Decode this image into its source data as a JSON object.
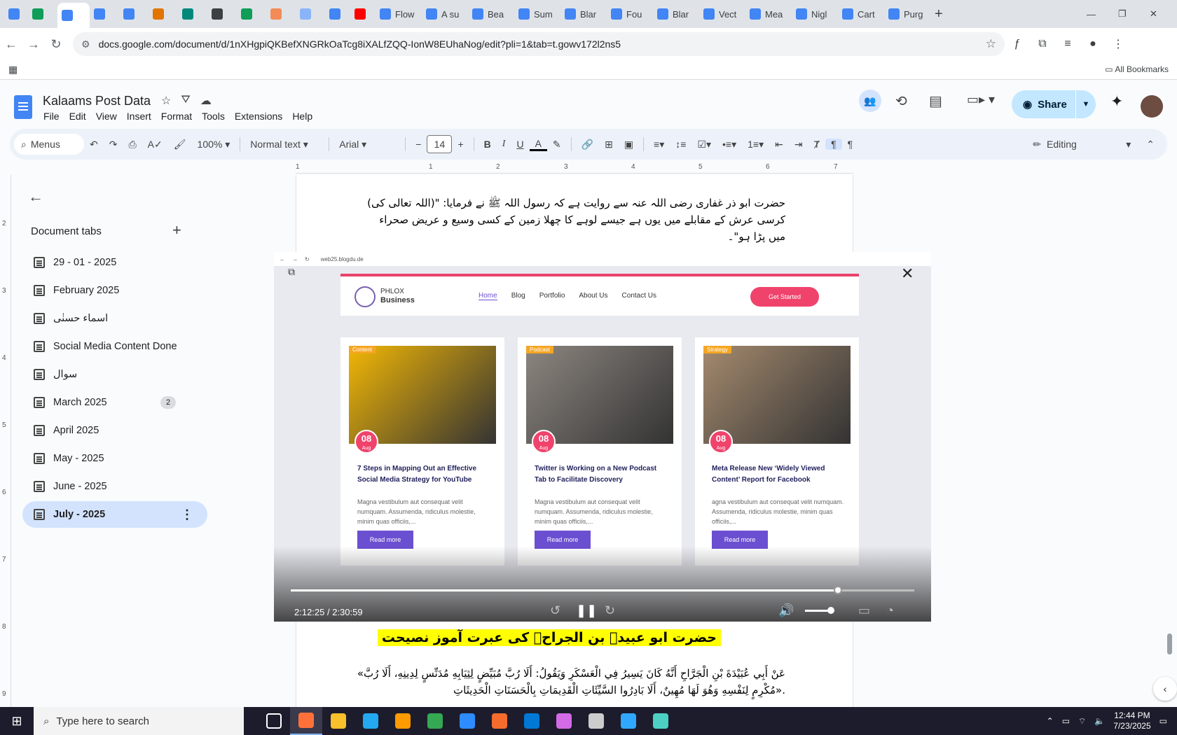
{
  "browser": {
    "tabs": [
      {
        "label": "",
        "color": "#4285f4"
      },
      {
        "label": "",
        "color": "#0f9d58"
      },
      {
        "label": "",
        "color": "#4285f4",
        "active": true
      },
      {
        "label": "",
        "color": "#4285f4"
      },
      {
        "label": "",
        "color": "#4285f4"
      },
      {
        "label": "",
        "color": "#e37400"
      },
      {
        "label": "",
        "color": "#00897b"
      },
      {
        "label": "",
        "color": "#3c4043"
      },
      {
        "label": "",
        "color": "#0f9d58"
      },
      {
        "label": "",
        "color": "#f28b55"
      },
      {
        "label": "",
        "color": "#8ab4f8"
      },
      {
        "label": "",
        "color": "#4285f4"
      },
      {
        "label": "",
        "color": "#ff0000"
      },
      {
        "label": "Flow",
        "color": "#4285f4"
      },
      {
        "label": "A su",
        "color": "#4285f4"
      },
      {
        "label": "Bea",
        "color": "#4285f4"
      },
      {
        "label": "Sum",
        "color": "#4285f4"
      },
      {
        "label": "Blar",
        "color": "#4285f4"
      },
      {
        "label": "Fou",
        "color": "#4285f4"
      },
      {
        "label": "Blar",
        "color": "#4285f4"
      },
      {
        "label": "Vect",
        "color": "#4285f4"
      },
      {
        "label": "Mea",
        "color": "#4285f4"
      },
      {
        "label": "Nigl",
        "color": "#4285f4"
      },
      {
        "label": "Cart",
        "color": "#4285f4"
      },
      {
        "label": "Purg",
        "color": "#4285f4"
      }
    ],
    "url": "docs.google.com/document/d/1nXHgpiQKBefXNGRkOaTcg8iXALfZQQ-IonW8EUhaNog/edit?pli=1&tab=t.gowv172l2ns5",
    "all_bookmarks": "All Bookmarks"
  },
  "doc": {
    "title": "Kalaams Post Data",
    "menu": [
      "File",
      "Edit",
      "View",
      "Insert",
      "Format",
      "Tools",
      "Extensions",
      "Help"
    ],
    "share_label": "Share"
  },
  "toolbar": {
    "menus_label": "Menus",
    "zoom": "100%",
    "style": "Normal text",
    "font": "Arial",
    "font_size": "14",
    "mode": "Editing"
  },
  "ruler": {
    "labels": [
      "1",
      "1",
      "2",
      "3",
      "4",
      "5",
      "6",
      "7"
    ]
  },
  "vruler": {
    "labels": [
      "2",
      "3",
      "4",
      "5",
      "6",
      "7",
      "8",
      "9"
    ]
  },
  "sidebar": {
    "heading": "Document tabs",
    "items": [
      {
        "label": "29 - 01 - 2025"
      },
      {
        "label": "February 2025"
      },
      {
        "label": "اسماء حسنٰی"
      },
      {
        "label": "Social Media Content Done"
      },
      {
        "label": "سوال"
      },
      {
        "label": "March 2025",
        "badge": "2"
      },
      {
        "label": "April 2025"
      },
      {
        "label": "May - 2025"
      },
      {
        "label": "June - 2025"
      },
      {
        "label": "July - 2025",
        "selected": true
      }
    ]
  },
  "content": {
    "para1": "حضرت ابو ذر غفاری رضی اللہ عنہ سے روایت ہے کہ رسول اللہ ﷺ نے فرمایا: \"(اللہ تعالی کی) کرسی عرش کے مقابلے میں یوں ہے جیسے لوہے کا چھلا زمین کے کسی وسیع و عریض صحراء میں پڑا ہو\"۔",
    "heading": "حضرت ابو عبیدہ بن الجراحؓ کی عبرت آموز نصیحت",
    "arabic_line1": "عَنْ أَبِي عُبَيْدَةَ بْنِ الْجَرَّاحِ أَنَّهُ كَانَ يَسِيرُ فِي الْعَسْكَرِ وَيَقُولُ: أَلَا رُبَّ مُبَيِّضٍ لِثِيَابِهِ مُدَنِّسٍ لِدِينِهِ، أَلَا رُبَّ»",
    "arabic_line2": ".«مُكْرِمٍ لِنَفْسِهِ وَهُوَ لَهَا مُهِينٌ، أَلَا بَادِرُوا السَّيِّئَاتِ الْقَدِيمَاتِ بِالْحَسَنَاتِ الْحَدِيثَاتِ"
  },
  "video": {
    "inner_url": "web25.blogdu.de",
    "site": {
      "brand_line1": "PHLOX",
      "brand_line2": "Business",
      "nav": [
        "Home",
        "Blog",
        "Portfolio",
        "About Us",
        "Contact Us"
      ],
      "cta": "Get Started"
    },
    "cards": [
      {
        "tag": "Content",
        "day": "08",
        "month": "Aug",
        "title": "7 Steps in Mapping Out an Effective Social Media Strategy for YouTube",
        "excerpt": "Magna vestibulum aut consequat velit numquam. Assumenda, ridiculus molestie, minim quas officiis,...",
        "button": "Read more",
        "image_color": "#f2b705"
      },
      {
        "tag": "Podcast",
        "day": "08",
        "month": "Aug",
        "title": "Twitter is Working on a New Podcast Tab to Facilitate Discovery",
        "excerpt": "Magna vestibulum aut consequat velit numquam. Assumenda, ridiculus molestie, minim quas officiis,...",
        "button": "Read more",
        "image_color": "#8d8680"
      },
      {
        "tag": "Strategy",
        "day": "08",
        "month": "Aug",
        "title": "Meta Release New ‘Widely Viewed Content’ Report for Facebook",
        "excerpt": "agna vestibulum aut consequat velit numquam. Assumenda, ridiculus molestie, minim quas officiis,...",
        "button": "Read more",
        "image_color": "#a58a6e"
      }
    ],
    "time": "2:12:25 / 2:30:59",
    "progress": 0.877
  },
  "taskbar": {
    "search_placeholder": "Type here to search",
    "time": "12:44 PM",
    "date": "7/23/2025",
    "apps": [
      {
        "name": "task-view",
        "color": "#ffffff"
      },
      {
        "name": "firefox",
        "color": "#ff7139",
        "active": true
      },
      {
        "name": "file-explorer",
        "color": "#f8c02a"
      },
      {
        "name": "vscode",
        "color": "#23a9f2"
      },
      {
        "name": "illustrator",
        "color": "#ff9a00"
      },
      {
        "name": "chrome",
        "color": "#34a853"
      },
      {
        "name": "zoom",
        "color": "#2d8cff"
      },
      {
        "name": "app-orange",
        "color": "#f56c2d"
      },
      {
        "name": "outlook",
        "color": "#0078d4"
      },
      {
        "name": "app-gradient",
        "color": "#d36ae6"
      },
      {
        "name": "pen-tool",
        "color": "#cccccc"
      },
      {
        "name": "photoshop",
        "color": "#31a8ff"
      },
      {
        "name": "app-teal",
        "color": "#4dd0c4"
      }
    ]
  }
}
